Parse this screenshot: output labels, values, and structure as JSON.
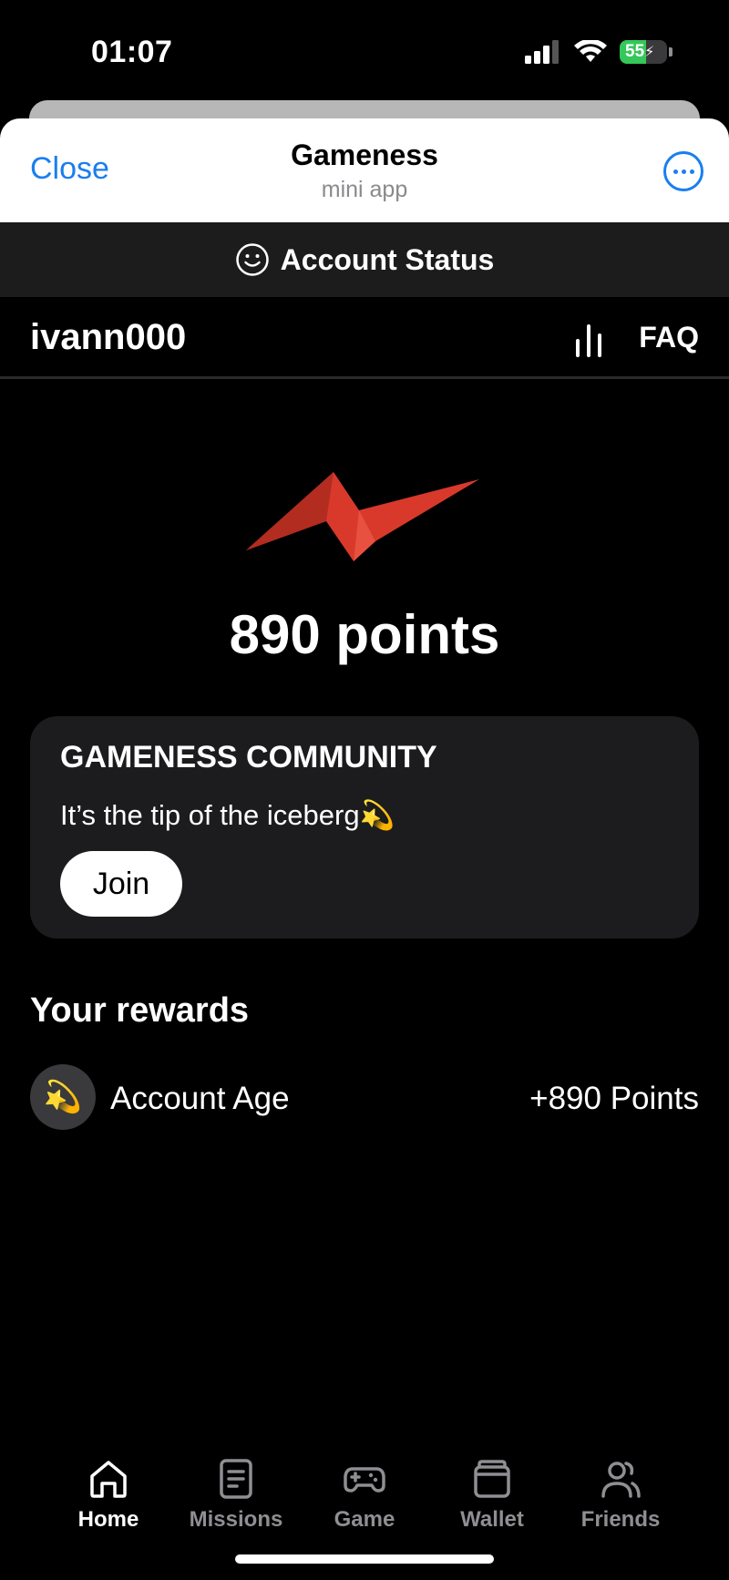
{
  "status_bar": {
    "time": "01:07",
    "battery": "55",
    "battery_level": 0.55
  },
  "header": {
    "close_label": "Close",
    "title": "Gameness",
    "subtitle": "mini app"
  },
  "account_bar": {
    "label": "Account Status"
  },
  "top_row": {
    "username": "ivann000",
    "faq_label": "FAQ"
  },
  "hero": {
    "points": "890 points",
    "logo_color": "#d8392b"
  },
  "community": {
    "title": "GAMENESS COMMUNITY",
    "text": "It’s the tip of the iceberg",
    "emoji": "💫",
    "join_label": "Join"
  },
  "rewards": {
    "heading": "Your rewards",
    "items": [
      {
        "icon": "💫",
        "name": "Account Age",
        "value": "+890 Points"
      }
    ]
  },
  "tabs": [
    {
      "label": "Home",
      "icon": "home-icon",
      "active": true
    },
    {
      "label": "Missions",
      "icon": "document-icon",
      "active": false
    },
    {
      "label": "Game",
      "icon": "gamepad-icon",
      "active": false
    },
    {
      "label": "Wallet",
      "icon": "wallet-icon",
      "active": false
    },
    {
      "label": "Friends",
      "icon": "friends-icon",
      "active": false
    }
  ],
  "colors": {
    "accent_blue": "#1a7ef0",
    "battery_green": "#34c759",
    "card_bg": "#1c1c1e"
  }
}
